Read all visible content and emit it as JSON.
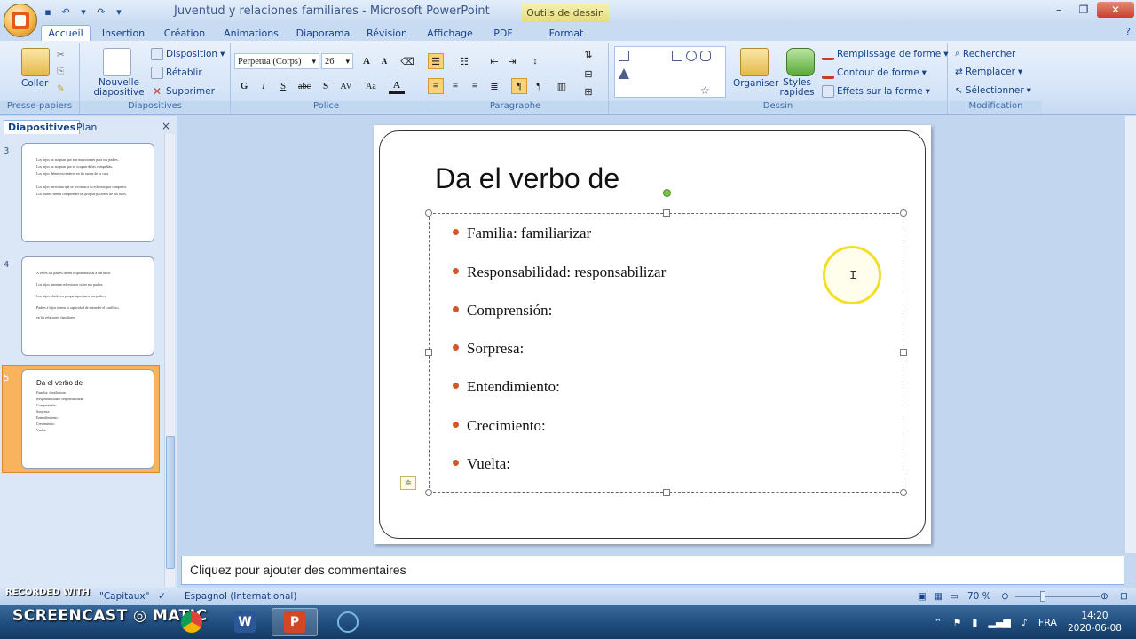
{
  "window": {
    "title": "Juventud y relaciones familiares - Microsoft PowerPoint",
    "context_tab": "Outils de dessin"
  },
  "tabs": [
    "Accueil",
    "Insertion",
    "Création",
    "Animations",
    "Diaporama",
    "Révision",
    "Affichage",
    "PDF",
    "Format"
  ],
  "ribbon": {
    "clipboard": {
      "paste": "Coller",
      "label": "Presse-papiers"
    },
    "slides": {
      "new_slide": "Nouvelle diapositive",
      "layout": "Disposition",
      "reset": "Rétablir",
      "delete": "Supprimer",
      "label": "Diapositives"
    },
    "font": {
      "name": "Perpetua (Corps)",
      "size": "26",
      "label": "Police"
    },
    "paragraph": {
      "label": "Paragraphe"
    },
    "drawing": {
      "arrange": "Organiser",
      "quick_styles": "Styles rapides",
      "fill": "Remplissage de forme",
      "outline": "Contour de forme",
      "effects": "Effets sur la forme",
      "label": "Dessin"
    },
    "editing": {
      "find": "Rechercher",
      "replace": "Remplacer",
      "select": "Sélectionner",
      "label": "Modification"
    }
  },
  "left_panel": {
    "tab_slides": "Diapositives",
    "tab_outline": "Plan",
    "thumbnails": [
      {
        "num": "3",
        "lines": [
          "Los hijos no aceptan que son importantes para sus padres.",
          "Los hijos no aceptan que se ocupan de las compañías.",
          "Los hijos deben esconderse en las tareas de la casa.",
          "Los hijos necesitan que se reconozca su esfuerzo por compartir.",
          "Los padres deben comprender las propias pasiones de sus hijos."
        ]
      },
      {
        "num": "4",
        "lines": [
          "A veces los padres deben responsabilizar a sus hijos.",
          "Los hijos intentan reflexionar sobre sus padres.",
          "Los hijos obedecen porque aprecian a sus padres.",
          "Padres e hijos tienen la capacidad de entender el conflicto,",
          "en las relaciones familiares."
        ]
      },
      {
        "num": "5",
        "title": "Da el verbo de",
        "lines": [
          "Familia: familiarizar",
          "Responsabilidad: responsabilizar",
          "Comprensión:",
          "Sorpresa:",
          "Entendimiento:",
          "Crecimiento:",
          "Vuelta:"
        ]
      }
    ]
  },
  "slide": {
    "title": "Da el verbo de",
    "bullets": [
      "Familia: familiarizar",
      "Responsabilidad: responsabilizar",
      "Comprensión:",
      "Sorpresa:",
      "Entendimiento:",
      "Crecimiento:",
      "Vuelta:"
    ]
  },
  "notes": {
    "placeholder": "Cliquez pour ajouter des commentaires"
  },
  "status": {
    "recorded_with": "RECORDED WITH",
    "theme": "\"Capitaux\"",
    "language": "Espagnol (International)",
    "zoom": "70 %"
  },
  "taskbar": {
    "brand": "SCREENCAST ◎ MATIC",
    "language": "FRA",
    "time": "14:20",
    "date": "2020-06-08"
  }
}
